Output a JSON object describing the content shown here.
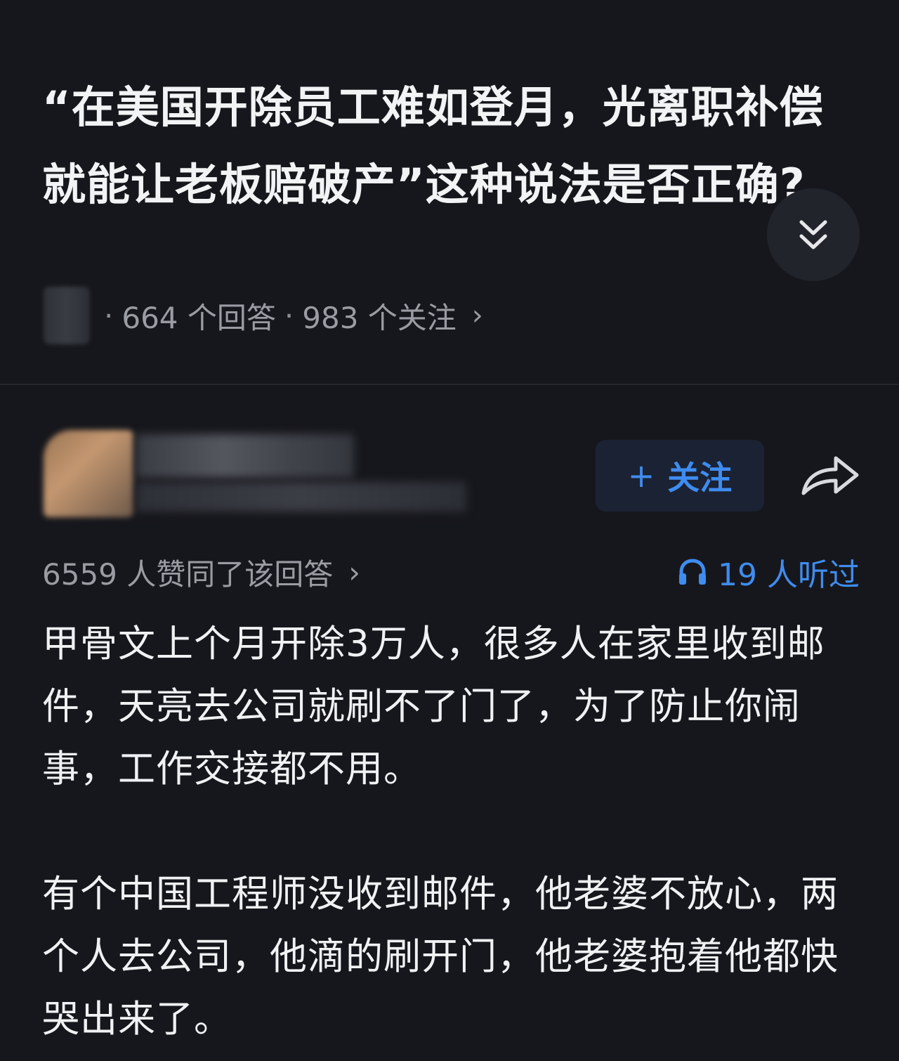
{
  "question": {
    "title": "“在美国开除员工难如登月，光离职补偿就能让老板赔破产”这种说法是否正确?",
    "answer_count_text": "664 个回答",
    "follow_count_text": "983 个关注",
    "separator": "·",
    "chevron": "›"
  },
  "answer": {
    "follow_label": "关注",
    "follow_plus": "+",
    "approve_text": "6559 人赞同了该回答",
    "approve_chevron": "›",
    "listen_text": "19 人听过",
    "paragraphs": [
      "甲骨文上个月开除3万人，很多人在家里收到邮件，天亮去公司就刷不了门了，为了防止你闹事，工作交接都不用。",
      "有个中国工程师没收到邮件，他老婆不放心，两个人去公司，他滴的刷开门，他老婆抱着他都快哭出来了。"
    ]
  },
  "colors": {
    "background": "#16171c",
    "accent": "#3f8cf0",
    "muted_text": "#9a9ca3"
  },
  "icons": [
    "chevrons-down-icon",
    "share-icon",
    "headphones-icon"
  ]
}
